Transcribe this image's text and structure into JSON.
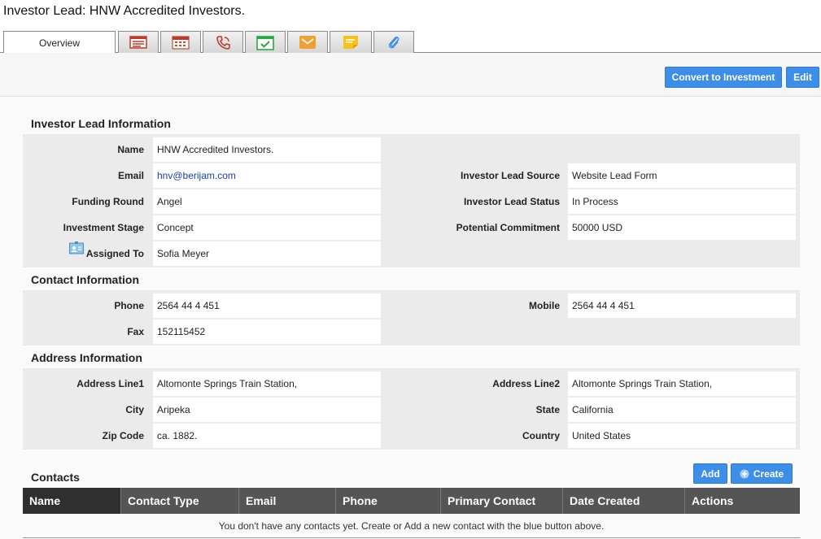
{
  "header": {
    "title": "Investor Lead: HNW Accredited Investors."
  },
  "tabs": [
    {
      "label": "Overview",
      "icon": "overview-tab"
    },
    {
      "label": "",
      "icon": "list-icon"
    },
    {
      "label": "",
      "icon": "calendar-icon"
    },
    {
      "label": "",
      "icon": "phone-icon"
    },
    {
      "label": "",
      "icon": "task-check-icon"
    },
    {
      "label": "",
      "icon": "email-icon"
    },
    {
      "label": "",
      "icon": "note-icon"
    },
    {
      "label": "",
      "icon": "paperclip-icon"
    }
  ],
  "toolbar": {
    "convert_label": "Convert to Investment",
    "edit_label": "Edit"
  },
  "lead_info": {
    "title": "Investor Lead Information",
    "name_label": "Name",
    "name": "HNW Accredited Investors.",
    "email_label": "Email",
    "email": "hnv@berijam.com",
    "funding_round_label": "Funding Round",
    "funding_round": "Angel",
    "investment_stage_label": "Investment Stage",
    "investment_stage": "Concept",
    "assigned_to_label": "Assigned To",
    "assigned_to": "Sofia Meyer",
    "lead_source_label": "Investor Lead Source",
    "lead_source": "Website Lead Form",
    "lead_status_label": "Investor Lead Status",
    "lead_status": "In Process",
    "potential_commitment_label": "Potential Commitment",
    "potential_commitment": "50000 USD"
  },
  "contact_info": {
    "title": "Contact Information",
    "phone_label": "Phone",
    "phone": "2564 44 4 451",
    "fax_label": "Fax",
    "fax": "152115452",
    "mobile_label": "Mobile",
    "mobile": "2564 44 4 451"
  },
  "address_info": {
    "title": "Address Information",
    "line1_label": "Address Line1",
    "line1": "Altomonte Springs Train Station,",
    "line2_label": "Address Line2",
    "line2": "Altomonte Springs Train Station,",
    "city_label": "City",
    "city": "Aripeka",
    "state_label": "State",
    "state": "California",
    "zip_label": "Zip Code",
    "zip": "ca. 1882.",
    "country_label": "Country",
    "country": "United States"
  },
  "contacts": {
    "title": "Contacts",
    "add_label": "Add",
    "create_label": "Create",
    "columns": [
      "Name",
      "Contact Type",
      "Email",
      "Phone",
      "Primary Contact",
      "Date Created",
      "Actions"
    ],
    "empty_message": "You don't have any contacts yet. Create or Add a new contact with the blue button above."
  },
  "colors": {
    "accent": "#3d8ee8",
    "table_header": "#555555",
    "panel": "#ebebeb"
  }
}
